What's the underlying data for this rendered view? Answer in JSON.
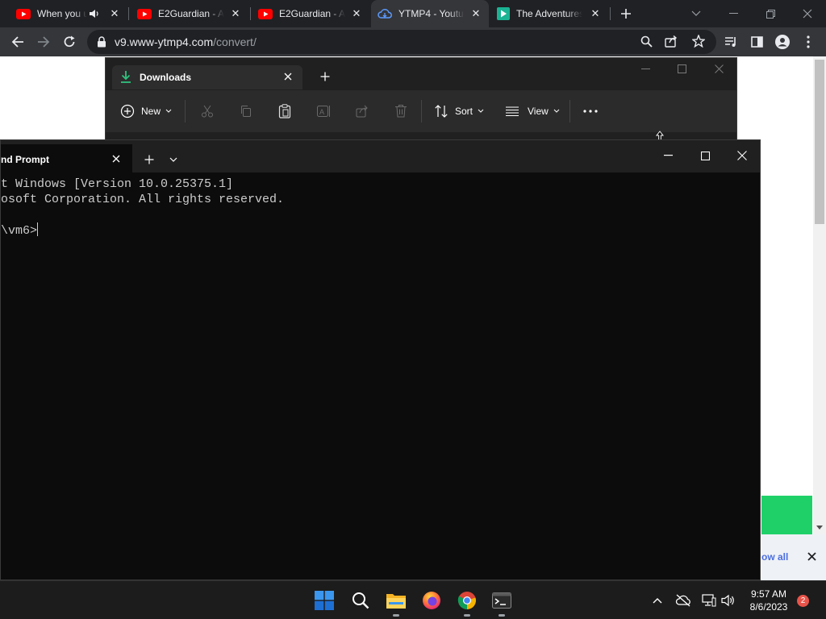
{
  "browser": {
    "tabs": [
      {
        "title": "When you u",
        "icon": "youtube-icon",
        "audio": true
      },
      {
        "title": "E2Guardian - Ac",
        "icon": "youtube-icon"
      },
      {
        "title": "E2Guardian - Ac",
        "icon": "youtube-icon"
      },
      {
        "title": "YTMP4 - Youtub",
        "icon": "cloud-download-icon",
        "active": true
      },
      {
        "title": "The Adventures",
        "icon": "play-icon"
      }
    ],
    "url_host": "v9.www-ytmp4.com",
    "url_path": "/convert/",
    "page": {
      "show_all_text": "ow all"
    }
  },
  "explorer": {
    "tab_title": "Downloads",
    "toolbar": {
      "new_label": "New",
      "sort_label": "Sort",
      "view_label": "View"
    }
  },
  "terminal": {
    "tab_title": "nd Prompt",
    "lines": [
      "t Windows [Version 10.0.25375.1]",
      "osoft Corporation. All rights reserved.",
      "",
      "\\vm6>"
    ]
  },
  "taskbar": {
    "apps": [
      "start-icon",
      "search-icon",
      "file-explorer-icon",
      "firefox-icon",
      "chrome-icon",
      "terminal-icon"
    ],
    "time": "9:57 AM",
    "date": "8/6/2023",
    "notification_count": "2"
  },
  "colors": {
    "accent_green": "#1fd069",
    "youtube_red": "#ff0000",
    "windows_blue": "#0078d4"
  }
}
